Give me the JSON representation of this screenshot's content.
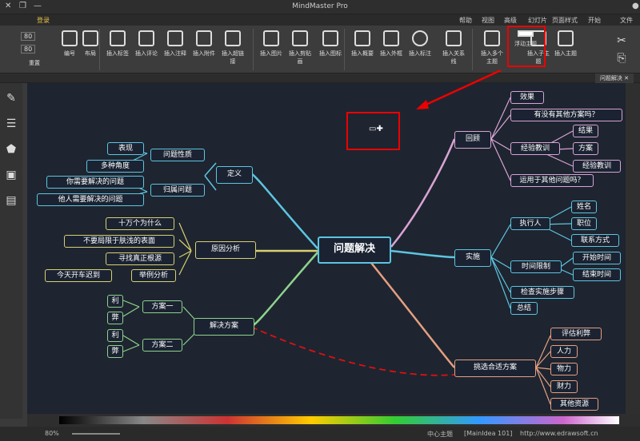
{
  "app": {
    "title": "MindMaster Pro",
    "quick": "登录"
  },
  "menu": [
    "文件",
    "开始",
    "页面样式",
    "幻灯片",
    "高级",
    "视图",
    "帮助"
  ],
  "ribbon": [
    "插入主题",
    "插入子主题",
    "浮动主题",
    "插入多个主题",
    "插入关系线",
    "插入标注",
    "插入外框",
    "插入概要",
    "插入图标",
    "插入剪贴画",
    "插入图片",
    "插入超链接",
    "插入附件",
    "插入注释",
    "插入评论",
    "插入标签",
    "布局",
    "编号",
    "重置"
  ],
  "zoom": "80",
  "tab": "问题解决",
  "map": {
    "central": "问题解决",
    "branches": [
      {
        "label": "定义",
        "children": [
          {
            "label": "问题性质",
            "kids": [
              "表现",
              "多种角度"
            ]
          },
          {
            "label": "归属问题",
            "kids": [
              "你需要解决的问题",
              "他人需要解决的问题"
            ]
          }
        ]
      },
      {
        "label": "原因分析",
        "children": [
          {
            "label": "十万个为什么",
            "kids": []
          },
          {
            "label": "不要局限于肤浅的表面",
            "kids": []
          },
          {
            "label": "寻找真正根源",
            "kids": []
          },
          {
            "label": "举例分析",
            "kids": [
              "今天开车迟到"
            ]
          }
        ]
      },
      {
        "label": "解决方案",
        "children": [
          {
            "label": "方案一",
            "kids": [
              "利",
              "弊"
            ]
          },
          {
            "label": "方案二",
            "kids": [
              "利",
              "弊"
            ]
          }
        ]
      },
      {
        "label": "回顾",
        "children": [
          {
            "label": "效果",
            "kids": []
          },
          {
            "label": "有没有其他方案吗？",
            "kids": []
          },
          {
            "label": "经验教训",
            "kids": [
              "结果",
              "方案",
              "经验教训"
            ]
          },
          {
            "label": "运用于其他问题吗？",
            "kids": []
          }
        ]
      },
      {
        "label": "实施",
        "children": [
          {
            "label": "执行人",
            "kids": [
              "姓名",
              "职位",
              "联系方式"
            ]
          },
          {
            "label": "时间限制",
            "kids": [
              "开始时间",
              "结束时间"
            ]
          },
          {
            "label": "检查实施步骤",
            "kids": []
          },
          {
            "label": "总结",
            "kids": []
          }
        ]
      },
      {
        "label": "挑选合适方案",
        "children": [
          {
            "label": "评估利弊",
            "kids": []
          },
          {
            "label": "人力",
            "kids": []
          },
          {
            "label": "物力",
            "kids": []
          },
          {
            "label": "财力",
            "kids": []
          },
          {
            "label": "其他资源",
            "kids": []
          }
        ]
      }
    ]
  },
  "status": {
    "url": "http://www.edrawsoft.cn",
    "idea": "[MainIdea 101]",
    "center": "中心主题",
    "zoom": "80%"
  }
}
